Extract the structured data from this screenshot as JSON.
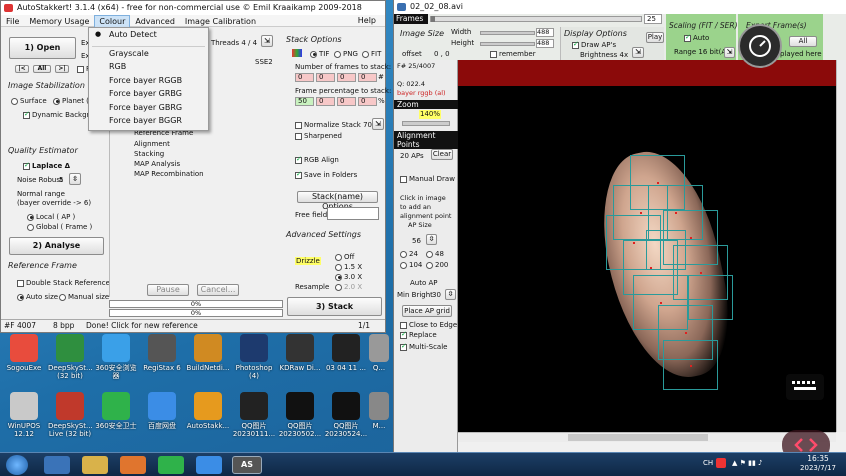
{
  "app": {
    "title": "AutoStakkert! 3.1.4 (x64) - free for non-commercial use © Emil Kraaikamp 2009-2018",
    "menu": [
      "File",
      "Memory Usage",
      "Colour",
      "Advanced",
      "Image Calibration",
      "Help"
    ],
    "open_btn": "1) Open",
    "ex": "Ex",
    "nav": [
      "|<",
      "All",
      ">|"
    ],
    "threads": "Threads 4 / 4",
    "sse": "SSE2",
    "image_stabilization": {
      "title": "Image Stabilization",
      "surface": "Surface",
      "planet": "Planet (C",
      "dynamic": "Dynamic Backgrou"
    },
    "quality": {
      "title": "Quality Estimator",
      "laplace": "Laplace Δ",
      "noise": "Noise Robust",
      "noise_val": "5",
      "normal1": "Normal range",
      "normal2": "(bayer override -> 6)",
      "local": "Local     ( AP )",
      "global": "Global    ( Frame )"
    },
    "analyse_btn": "2) Analyse",
    "reference": {
      "title": "Reference Frame",
      "double": "Double Stack Reference",
      "auto": "Auto size",
      "manual": "Manual size"
    },
    "progress_list": [
      "Reference Frame",
      "Alignment",
      "Stacking",
      "MAP Analysis",
      "MAP Recombination"
    ],
    "pause": "Pause",
    "cancel": "Cancel...",
    "pct1": "0%",
    "pct2": "0%",
    "stack_options": {
      "title": "Stack Options",
      "tif": "TIF",
      "png": "PNG",
      "fit": "FIT",
      "frames_label": "Number of frames to stack:",
      "frames_vals": [
        "0",
        "0",
        "0",
        "0"
      ],
      "pct_label": "Frame percentage to stack:",
      "pct_vals": [
        "50",
        "0",
        "0",
        "0"
      ],
      "pct_unit": "%",
      "hash": "#",
      "normalize": "Normalize Stack 70%",
      "sharpened": "Sharpened",
      "rgb": "RGB Align",
      "save": "Save in Folders",
      "stackname": "Stack(name) Options",
      "free": "Free field"
    },
    "advanced": {
      "title": "Advanced Settings",
      "drizzle": "Drizzle",
      "off": "Off",
      "x15": "1.5 X",
      "x30": "3.0 X",
      "resample": "Resample",
      "x20": "2.0 X"
    },
    "stack_btn": "3) Stack",
    "status": {
      "frame": "#F 4007",
      "bpp": "8 bpp",
      "msg": "Done! Click for new reference",
      "page": "1/1"
    }
  },
  "colour_menu": [
    "Auto Detect",
    "Grayscale",
    "RGB",
    "Force bayer RGGB",
    "Force bayer GRBG",
    "Force bayer GBRG",
    "Force bayer BGGR"
  ],
  "viewer": {
    "title": "02_02_08.avi",
    "frames": "Frames",
    "frame_num": "25",
    "image_size": {
      "title": "Image Size",
      "width": "Width",
      "height": "Height",
      "w": "488",
      "h": "488",
      "offset": "offset",
      "off_val": "0 , 0",
      "remember": "remember"
    },
    "display": {
      "title": "Display Options",
      "draw": "Draw AP's",
      "brightness": "Brightness 4x",
      "play": "Play"
    },
    "scaling": {
      "title": "Scaling (FIT / SER)",
      "auto": "Auto",
      "range": "Range 16 bit(A)",
      "all": "All"
    },
    "export": {
      "title": "Export Frame(s)",
      "played": "played here"
    },
    "info": [
      "F# 25/4007",
      "Q: 022.4",
      "bayer rggb (al)"
    ],
    "zoom": {
      "label": "Zoom",
      "value": "140%"
    },
    "ap_title": "Alignment Points",
    "aps": "20 APs",
    "clear": "Clear",
    "manual": "Manual Draw",
    "click_text": [
      "Click in image",
      "to add an",
      "alignment point"
    ],
    "ap_size": "AP Size",
    "ap_val": "56",
    "sizes": [
      "24",
      "48",
      "104",
      "200"
    ],
    "auto_ap": "Auto AP",
    "min_bright": "Min Bright",
    "min_val": "30",
    "place": "Place AP grid",
    "edge": "Close to Edge",
    "replace": "Replace",
    "multi": "Multi-Scale"
  },
  "desktop_icons": [
    {
      "label": "SogouExe",
      "color": "#e84c3d"
    },
    {
      "label": "DeepSkySt... (32 bit)",
      "color": "#2f8f3f"
    },
    {
      "label": "360安全浏览器",
      "color": "#3aa0e8"
    },
    {
      "label": "RegiStax 6",
      "color": "#555555"
    },
    {
      "label": "BuildNetdi...",
      "color": "#d08a22"
    },
    {
      "label": "Photoshop (4)",
      "color": "#1d3a6e"
    },
    {
      "label": "KDRaw Di...",
      "color": "#333333"
    },
    {
      "label": "03 04 11 ...",
      "color": "#222222"
    },
    {
      "label": "Q...",
      "color": "#999999"
    },
    {
      "label": "WinUPOS 12.12",
      "color": "#c9c9c9"
    },
    {
      "label": "DeepSkySt... Live (32 bit)",
      "color": "#c0392b"
    },
    {
      "label": "360安全卫士",
      "color": "#2fb24a"
    },
    {
      "label": "百度网盘",
      "color": "#3b8de6"
    },
    {
      "label": "AutoStakk...",
      "color": "#e69a1e"
    },
    {
      "label": "QQ图片 20230111...",
      "color": "#222222"
    },
    {
      "label": "QQ图片 20230502...",
      "color": "#111111"
    },
    {
      "label": "QQ图片 20230524...",
      "color": "#111111"
    },
    {
      "label": "M...",
      "color": "#888888"
    }
  ],
  "taskbar": {
    "ime": "CH",
    "time": "16:35",
    "date": "2023/7/17"
  }
}
